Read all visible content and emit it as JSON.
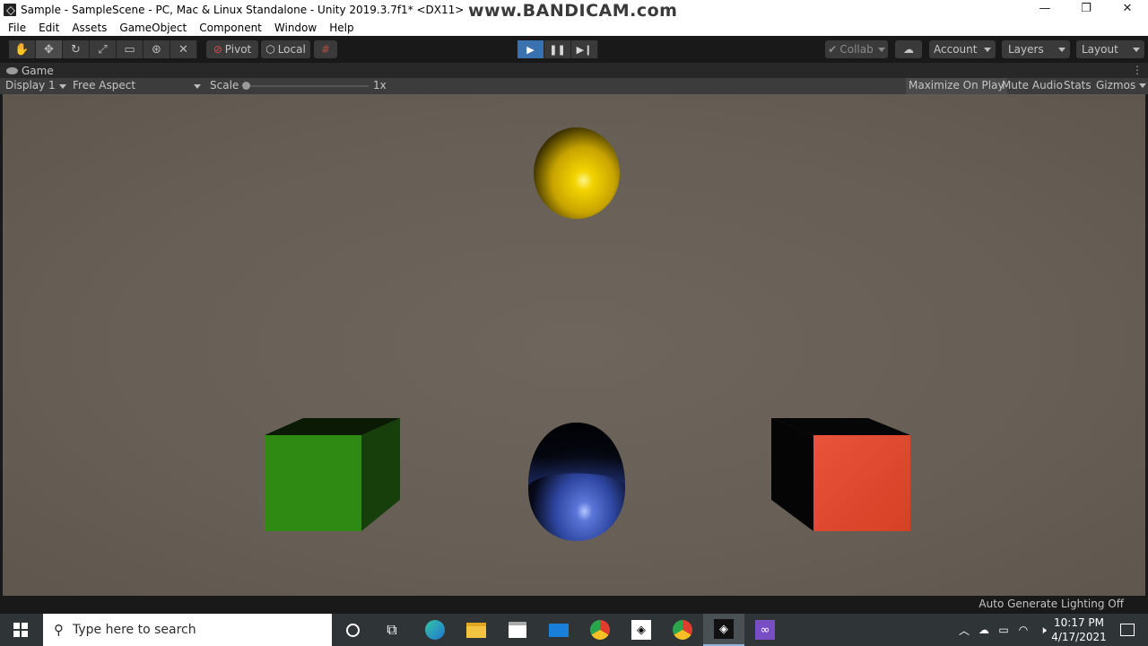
{
  "window": {
    "title": "Sample - SampleScene - PC, Mac & Linux Standalone - Unity 2019.3.7f1* <DX11>",
    "watermark": "www.BANDICAM.com",
    "minimize": "—",
    "restore": "❐",
    "close": "✕"
  },
  "menu": {
    "items": [
      "File",
      "Edit",
      "Assets",
      "GameObject",
      "Component",
      "Window",
      "Help"
    ]
  },
  "toolbar": {
    "pivot_label": "Pivot",
    "local_label": "Local",
    "collab_label": "Collab",
    "account_label": "Account",
    "layers_label": "Layers",
    "layout_label": "Layout",
    "tool_icons": [
      "hand-tool-icon",
      "move-tool-icon",
      "rotate-tool-icon",
      "scale-tool-icon",
      "rect-tool-icon",
      "transform-tool-icon",
      "custom-tool-icon"
    ],
    "play_state": "playing"
  },
  "game_view": {
    "tab_label": "Game",
    "display_label": "Display 1",
    "aspect_label": "Free Aspect",
    "scale_label": "Scale",
    "scale_value": "1x",
    "maximize_label": "Maximize On Play",
    "mute_label": "Mute Audio",
    "stats_label": "Stats",
    "gizmos_label": "Gizmos",
    "scene_objects": [
      "yellow-sphere",
      "green-cube",
      "blue-capsule",
      "red-cube"
    ],
    "colors": {
      "background": "#675f55",
      "sphere": "#f2d000",
      "green_cube": "#2f8a10",
      "capsule": "#3c5cc0",
      "red_cube": "#e04a2a"
    }
  },
  "status": {
    "lighting_label": "Auto Generate Lighting Off"
  },
  "taskbar": {
    "search_placeholder": "Type here to search",
    "time": "10:17 PM",
    "date": "4/17/2021"
  }
}
